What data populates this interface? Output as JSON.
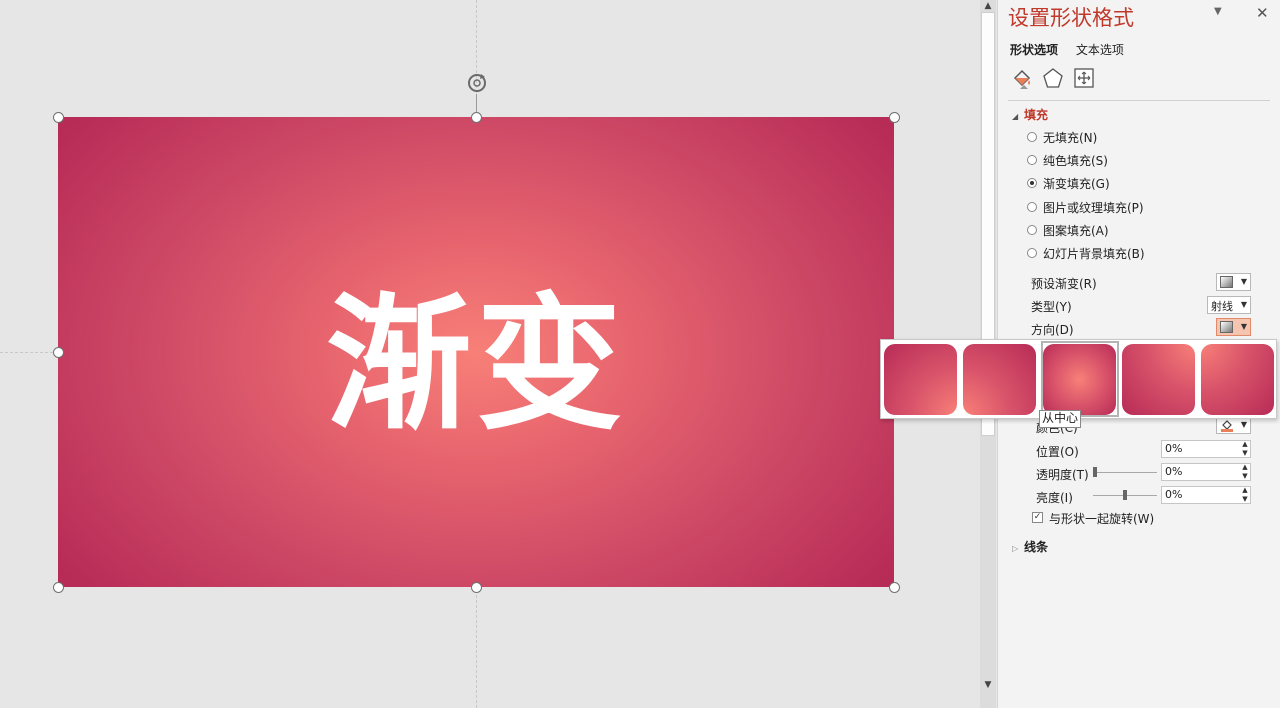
{
  "slide": {
    "text": "渐变"
  },
  "panel": {
    "title": "设置形状格式",
    "dropdown_icon": "chevron-down-icon",
    "close_icon": "close-icon",
    "tabs": [
      "形状选项",
      "文本选项"
    ],
    "icons": [
      "fill-line-icon",
      "effects-pentagon-icon",
      "size-properties-icon"
    ],
    "fill_section": "填充",
    "fill_options": [
      {
        "label": "无填充(N)",
        "checked": false
      },
      {
        "label": "纯色填充(S)",
        "checked": false
      },
      {
        "label": "渐变填充(G)",
        "checked": true
      },
      {
        "label": "图片或纹理填充(P)",
        "checked": false
      },
      {
        "label": "图案填充(A)",
        "checked": false
      },
      {
        "label": "幻灯片背景填充(B)",
        "checked": false
      }
    ],
    "preset_label": "预设渐变(R)",
    "type_label": "类型(Y)",
    "type_value": "射线",
    "direction_label": "方向(D)",
    "color_label": "颜色(C)",
    "position_label": "位置(O)",
    "position_value": "0%",
    "transparency_label": "透明度(T)",
    "transparency_value": "0%",
    "brightness_label": "亮度(I)",
    "brightness_value": "0%",
    "rotate_label": "与形状一起旋转(W)",
    "rotate_checked": true,
    "line_section": "线条"
  },
  "gallery": {
    "tooltip": "从中心",
    "selected_index": 2
  },
  "colors": {
    "accent": "#c0392b",
    "gradient_center": "#f88078",
    "gradient_edge": "#b72b57"
  }
}
